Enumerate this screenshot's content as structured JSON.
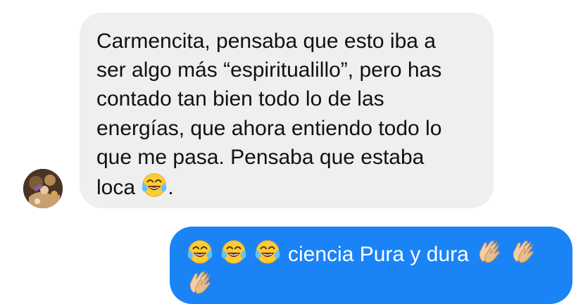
{
  "thread": {
    "incoming": {
      "lines": [
        "Carmencita, pensaba que esto iba a",
        "ser algo más “espiritualillo”, pero has",
        "contado tan bien todo lo de las",
        "energías, que ahora entiendo todo lo",
        "que me pasa. Pensaba que estaba",
        "loca "
      ],
      "trailing": ".",
      "emoji": "face-with-tears-of-joy"
    },
    "outgoing": {
      "text": "ciencia Pura y dura",
      "leading_emojis": [
        "face-with-tears-of-joy",
        "face-with-tears-of-joy",
        "face-with-tears-of-joy"
      ],
      "trailing_emojis": [
        "clapping-hands",
        "clapping-hands",
        "clapping-hands"
      ]
    }
  },
  "colors": {
    "incoming_bubble": "#efeff0",
    "outgoing_bubble": "#1a84f6",
    "incoming_text": "#111111",
    "outgoing_text": "#ffffff"
  }
}
